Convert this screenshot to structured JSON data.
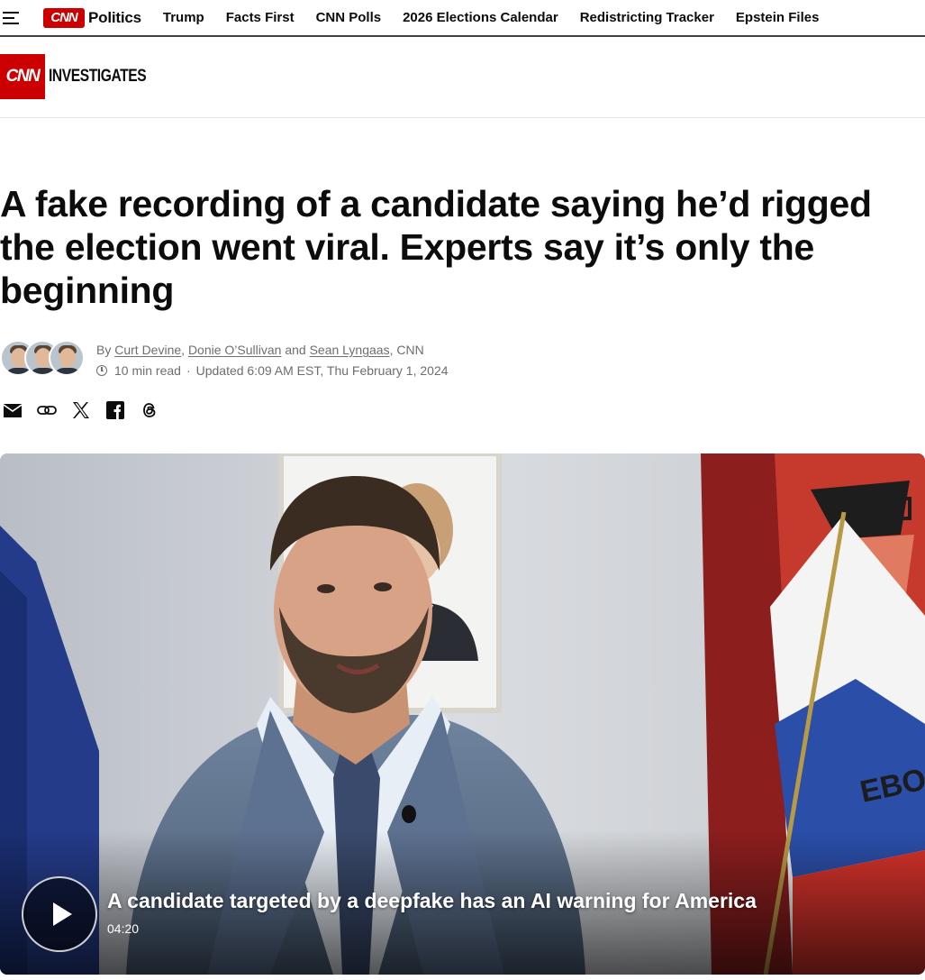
{
  "nav": {
    "logo_text": "CNN",
    "section": "Politics",
    "links": [
      "Trump",
      "Facts First",
      "CNN Polls",
      "2026 Elections Calendar",
      "Redistricting Tracker",
      "Epstein Files"
    ]
  },
  "investigates": {
    "logo_text": "CNN",
    "label": "INVESTIGATES"
  },
  "article": {
    "headline": "A fake recording of a candidate saying he’d rigged the election went viral. Experts say it’s only the beginning",
    "byline": {
      "prefix": "By",
      "authors": [
        "Curt Devine",
        "Donie O’Sullivan",
        "Sean Lyngaas"
      ],
      "sep1": ",",
      "conj": "and",
      "suffix": ", CNN",
      "read_time": "10 min read",
      "updated": "Updated 6:09 AM EST, Thu February 1, 2024"
    },
    "share_icons": [
      "email-icon",
      "link-icon",
      "x-icon",
      "facebook-icon",
      "threads-icon"
    ]
  },
  "video": {
    "title": "A candidate targeted by a deepfake has an AI warning for America",
    "duration": "04:20",
    "sign_text": "EBOJTE"
  },
  "colors": {
    "cnn_red": "#cc0000",
    "text": "#0c0c0c",
    "muted": "#6e6e6e"
  }
}
